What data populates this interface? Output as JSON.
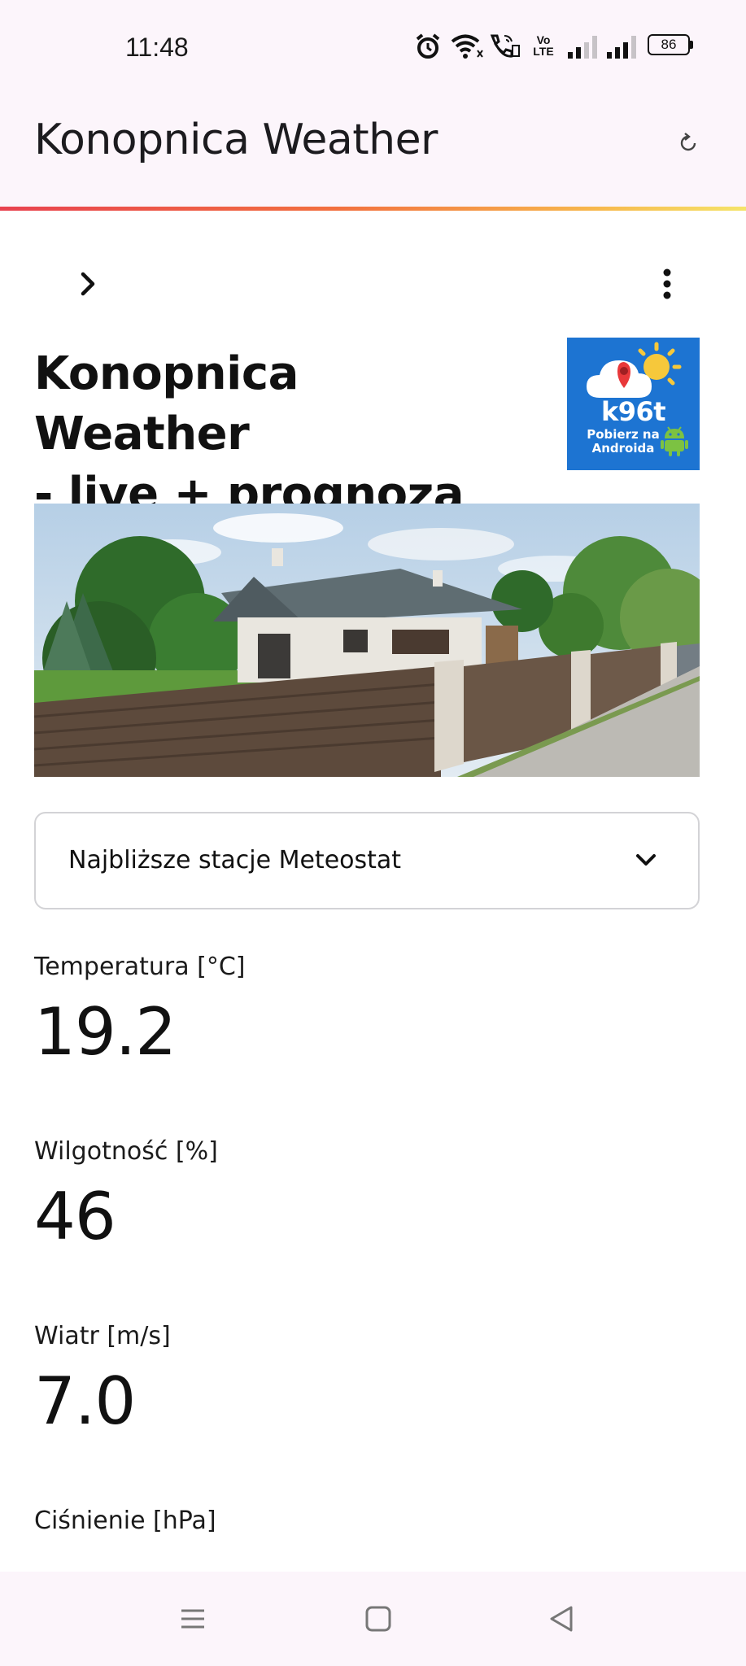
{
  "status_bar": {
    "time": "11:48",
    "volte_label": "Vo LTE",
    "battery_level": "86",
    "icons": [
      "alarm-icon",
      "wifi-icon",
      "wifi-calling-icon",
      "volte-icon",
      "signal-sim1-icon",
      "signal-sim2-icon",
      "battery-icon"
    ]
  },
  "app_bar": {
    "title": "Konopnica Weather",
    "refresh_icon": "refresh-icon"
  },
  "toolbar": {
    "expand_icon": "chevron-right-icon",
    "menu_icon": "more-vert-icon"
  },
  "page": {
    "title_line1": "Konopnica Weather",
    "title_line2": "- live + prognoza"
  },
  "promo": {
    "brand": "k96t",
    "sub_line1": "Pobierz na",
    "sub_line2": "Androida",
    "colors": {
      "background": "#1d74d2"
    }
  },
  "select": {
    "label": "Najbliższe stacje Meteostat",
    "icon": "chevron-down-icon"
  },
  "metrics": [
    {
      "label": "Temperatura [°C]",
      "value": "19.2"
    },
    {
      "label": "Wilgotność [%]",
      "value": "46"
    },
    {
      "label": "Wiatr [m/s]",
      "value": "7.0"
    },
    {
      "label": "Ciśnienie [hPa]",
      "value": ""
    }
  ],
  "nav_bar": {
    "icons": [
      "menu-icon",
      "home-icon",
      "back-icon"
    ]
  },
  "colors": {
    "bar_background": "#fcf5fb",
    "divider_start": "#e8424f",
    "divider_end": "#f5e46a"
  }
}
